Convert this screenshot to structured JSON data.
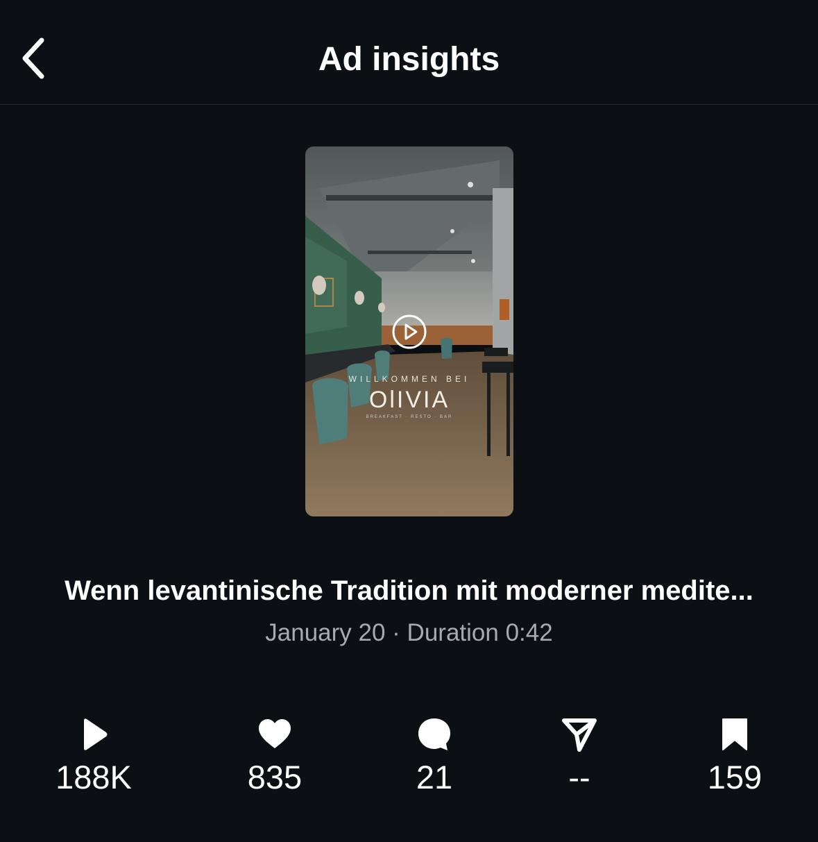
{
  "header": {
    "title": "Ad insights",
    "back_icon": "chevron-left-icon"
  },
  "media": {
    "overlay_welcome": "WILLKOMMEN BEI",
    "overlay_brand": "OlIVIA",
    "overlay_tagline": "BREAKFAST · RESTO · BAR",
    "play_icon": "play-circle-icon"
  },
  "post": {
    "caption": "Wenn levantinische Tradition mit moderner medite...",
    "meta": "January 20 · Duration 0:42"
  },
  "stats": [
    {
      "icon": "play-icon",
      "value": "188K"
    },
    {
      "icon": "heart-icon",
      "value": "835"
    },
    {
      "icon": "comment-icon",
      "value": "21"
    },
    {
      "icon": "share-icon",
      "value": "--"
    },
    {
      "icon": "bookmark-icon",
      "value": "159"
    }
  ],
  "colors": {
    "background": "#0c0f14",
    "text_primary": "#ffffff",
    "text_secondary": "#a6abb3"
  }
}
